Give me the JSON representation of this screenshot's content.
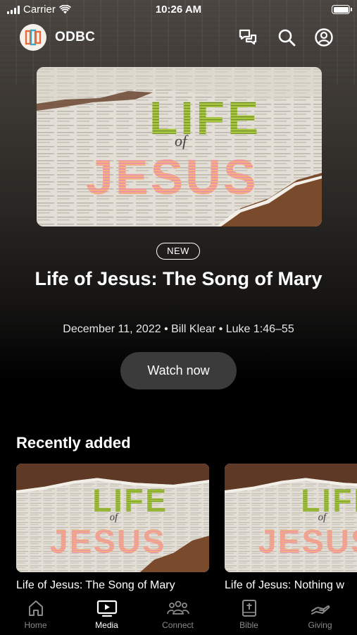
{
  "status_bar": {
    "carrier": "Carrier",
    "time": "10:26 AM"
  },
  "header": {
    "app_name": "ODBC",
    "logo_icon": "odbc-logo-icon"
  },
  "hero": {
    "badge": "NEW",
    "title": "Life of Jesus: The Song of Mary",
    "meta": "December 11, 2022 • Bill Klear • Luke 1:46–55",
    "watch_label": "Watch now",
    "artwork": {
      "line1": "LIFE",
      "line2": "of",
      "line3": "JESUS"
    }
  },
  "recent": {
    "title": "Recently added",
    "items": [
      {
        "caption": "Life of Jesus: The Song of Mary"
      },
      {
        "caption": "Life of Jesus: Nothing w"
      }
    ]
  },
  "tabs": [
    {
      "label": "Home",
      "icon": "home-icon",
      "active": false
    },
    {
      "label": "Media",
      "icon": "tv-icon",
      "active": true
    },
    {
      "label": "Connect",
      "icon": "people-icon",
      "active": false
    },
    {
      "label": "Bible",
      "icon": "bible-icon",
      "active": false
    },
    {
      "label": "Giving",
      "icon": "giving-hand-icon",
      "active": false
    }
  ],
  "colors": {
    "button_bg": "#3b3b3b",
    "inactive_tab": "#8a8a8a",
    "artwork_green": "#9bbf3a",
    "artwork_pink": "#e98a9a",
    "paper_bg": "#e8e4db",
    "wood": "#6b3e24"
  }
}
